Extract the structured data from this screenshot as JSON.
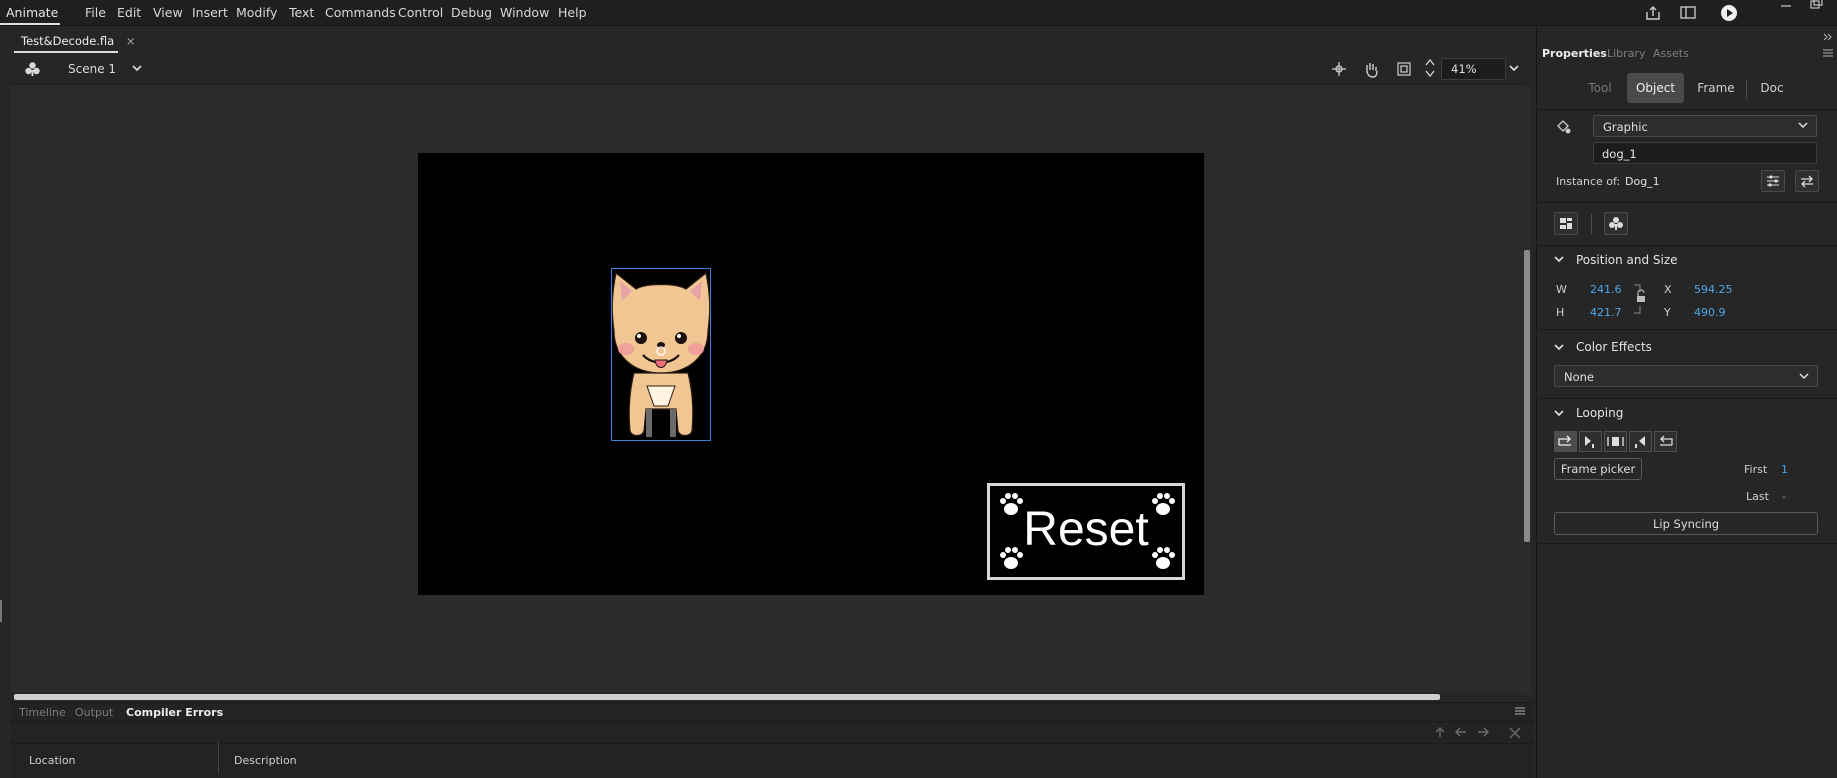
{
  "menubar": {
    "app_name": "Animate",
    "items": [
      "File",
      "Edit",
      "View",
      "Insert",
      "Modify",
      "Text",
      "Commands",
      "Control",
      "Debug",
      "Window",
      "Help"
    ]
  },
  "document": {
    "tab_title": "Test&Decode.fla",
    "close_glyph": "×"
  },
  "scenebar": {
    "scene_name": "Scene 1",
    "zoom": "41%"
  },
  "stage": {
    "background": "#000000",
    "reset_label": "Reset"
  },
  "bottom_panel": {
    "tabs": [
      "Timeline",
      "Output",
      "Compiler Errors"
    ],
    "active_tab": "Compiler Errors",
    "columns": [
      "Location",
      "Description"
    ]
  },
  "properties": {
    "panel_tabs": [
      "Properties",
      "Library",
      "Assets"
    ],
    "segments": [
      "Tool",
      "Object",
      "Frame",
      "Doc"
    ],
    "active_segment": "Object",
    "symbol_type": "Graphic",
    "instance_name": "dog_1",
    "instance_of_label": "Instance of:",
    "instance_of_value": "Dog_1",
    "position_size": {
      "title": "Position and Size",
      "w_label": "W",
      "w": "241.6",
      "h_label": "H",
      "h": "421.7",
      "x_label": "X",
      "x": "594.25",
      "y_label": "Y",
      "y": "490.9"
    },
    "color_effects": {
      "title": "Color Effects",
      "value": "None"
    },
    "looping": {
      "title": "Looping",
      "frame_picker": "Frame picker",
      "first_label": "First",
      "first": "1",
      "last_label": "Last",
      "last": "-",
      "lip_syncing": "Lip Syncing"
    }
  },
  "colors": {
    "accent_blue": "#4ea6e8",
    "selection_blue": "#3b7fd6",
    "dog_fur": "#f2c693"
  }
}
